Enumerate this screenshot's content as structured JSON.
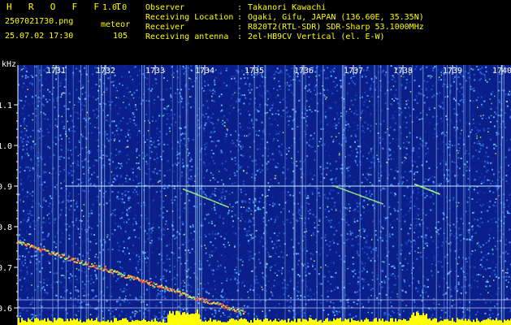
{
  "header": {
    "app_title": "H R O F F T",
    "version": "1.0.0",
    "filename": "2507021730.png",
    "datetime": "25.07.02 17:30",
    "event_type": "meteor",
    "event_count": "105"
  },
  "meta": [
    {
      "label": "Observer",
      "value": "Takanori Kawachi"
    },
    {
      "label": "Receiving Location",
      "value": "Ogaki, Gifu, JAPAN (136.60E, 35.35N)"
    },
    {
      "label": "Receiver",
      "value": "R820T2(RTL-SDR) SDR-Sharp 53.1000MHz"
    },
    {
      "label": "Receiving antenna",
      "value": "2el-HB9CV Vertical (el. E-W)"
    }
  ],
  "colon": ":",
  "spectrogram": {
    "y_unit": "kHz",
    "y_ticks": [
      "1.1",
      "1.0",
      "0.9",
      "0.8",
      "0.7",
      "0.6"
    ],
    "y_tick_values": [
      1.1,
      1.0,
      0.9,
      0.8,
      0.7,
      0.6
    ],
    "x_ticks": [
      "1731",
      "1732",
      "1733",
      "1734",
      "1735",
      "1736",
      "1737",
      "1738",
      "1739",
      "1740"
    ],
    "y_range_khz": [
      0.57,
      1.2
    ],
    "carrier_khz": 0.9,
    "guide_lines_khz": [
      0.62,
      0.6
    ],
    "colors": {
      "background": "#000000",
      "text_yellow": "#ffff00",
      "text_green": "#00e6a0",
      "carrier": "#c8f0ff",
      "guide": "#c0c0ff"
    }
  }
}
